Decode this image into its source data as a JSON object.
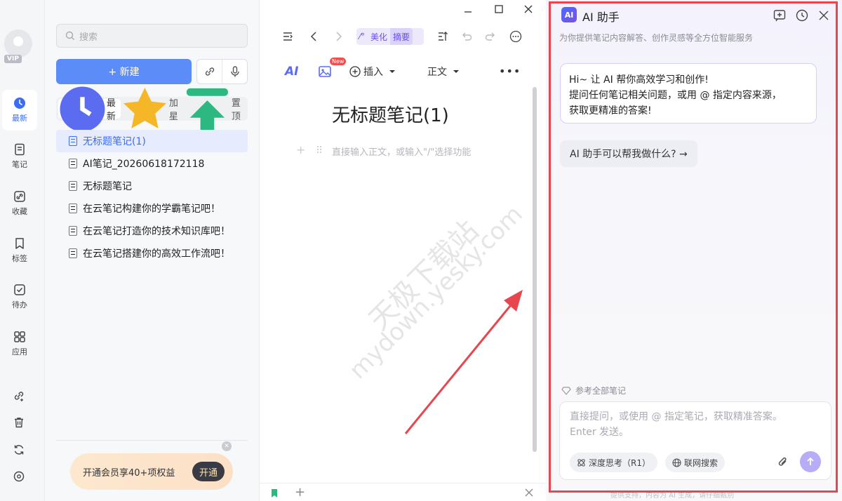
{
  "rail": {
    "vip_label": "VIP",
    "items": [
      {
        "label": "最新",
        "icon": "clock-icon"
      },
      {
        "label": "笔记",
        "icon": "note-icon"
      },
      {
        "label": "收藏",
        "icon": "link-icon"
      },
      {
        "label": "标签",
        "icon": "bookmark-icon"
      },
      {
        "label": "待办",
        "icon": "checkbox-icon"
      },
      {
        "label": "应用",
        "icon": "apps-icon"
      }
    ]
  },
  "list": {
    "search_placeholder": "搜索",
    "new_button": "+ 新建",
    "tabs": [
      {
        "label": "最新",
        "color": "#5b6cf0"
      },
      {
        "label": "加星",
        "color": "#f5b728"
      },
      {
        "label": "置顶",
        "color": "#2db882"
      }
    ],
    "notes": [
      "无标题笔记(1)",
      "AI笔记_20260618172118",
      "无标题笔记",
      "在云笔记构建你的学霸笔记吧！",
      "在云笔记打造你的技术知识库吧！",
      "在云笔记搭建你的高效工作流吧！"
    ],
    "promo_text": "开通会员享40+项权益",
    "promo_button": "开通"
  },
  "editor": {
    "beautify_label": "美化",
    "summary_label": "摘要",
    "ai_label": "AI",
    "new_badge": "New",
    "insert_label": "插入",
    "style_label": "正文",
    "title": "无标题笔记(1)",
    "hint": "直接输入正文，或输入\"/\"选择功能"
  },
  "watermark": {
    "line1": "天极下载站",
    "line2": "mydown.yesky.com"
  },
  "ai_panel": {
    "badge": "AI",
    "title": "AI 助手",
    "subtitle": "为你提供笔记内容解答、创作灵感等全方位智能服务",
    "greeting_line1": "Hi~ 让 AI 帮你高效学习和创作!",
    "greeting_line2": "提问任何笔记相关问题，或用 @ 指定内容来源，",
    "greeting_line3": "获取更精准的答案!",
    "suggestion": "AI 助手可以帮我做什么? →",
    "reference": "参考全部笔记",
    "input_placeholder": "直接提问，或使用 @ 指定笔记，获取精准答案。Enter 发送。",
    "chip_deep": "深度思考（R1）",
    "chip_web": "联网搜索",
    "footer": "提供支持，内容为 AI 生成，请仔细甄别",
    "accent": "#e8464f"
  }
}
